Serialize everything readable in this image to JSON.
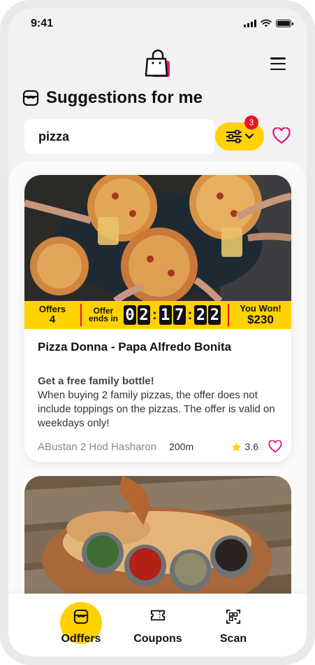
{
  "status_bar": {
    "time": "9:41"
  },
  "header": {
    "section_title": "Suggestions for me"
  },
  "search": {
    "value": "pizza",
    "placeholder": ""
  },
  "filter": {
    "badge_count": "3"
  },
  "colors": {
    "accent": "#ffd200",
    "danger": "#e8122b",
    "heart": "#e8127a"
  },
  "offer_card": {
    "offers_label": "Offers",
    "offers_value": "4",
    "ends_label": "Offer ends in",
    "timer": {
      "h1": "0",
      "h2": "2",
      "m1": "1",
      "m2": "7",
      "s1": "2",
      "s2": "2"
    },
    "won_label": "You Won!",
    "won_value": "$230",
    "title": "Pizza Donna - Papa Alfredo Bonita",
    "highlight": "Get a free family bottle!",
    "description": "When buying 2 family pizzas, the offer does not include toppings on the pizzas. The offer is valid on weekdays only!",
    "address": "ABustan 2 Hod Hasharon",
    "distance": "200m",
    "rating": "3.6"
  },
  "bottom_nav": {
    "items": [
      {
        "label": "Odffers",
        "icon": "store-icon",
        "active": true
      },
      {
        "label": "Coupons",
        "icon": "ticket-icon",
        "active": false
      },
      {
        "label": "Scan",
        "icon": "qr-scan-icon",
        "active": false
      }
    ]
  }
}
